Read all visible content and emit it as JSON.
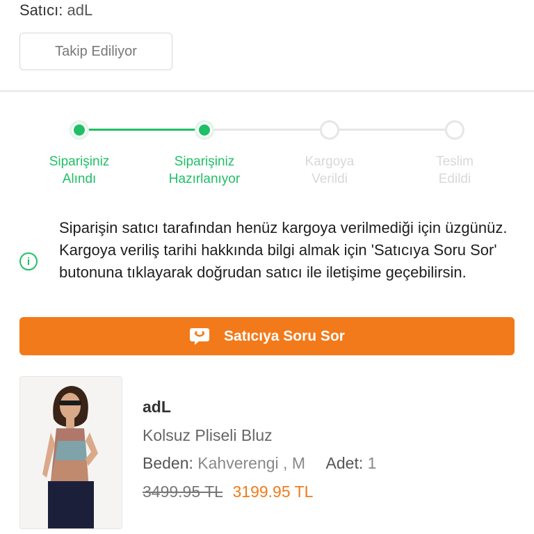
{
  "seller": {
    "label": "Satıcı:",
    "name": "adL",
    "follow_button": "Takip Ediliyor"
  },
  "tracker": {
    "steps": [
      {
        "label": "Siparişiniz\nAlındı",
        "status": "done"
      },
      {
        "label": "Siparişiniz\nHazırlanıyor",
        "status": "done"
      },
      {
        "label": "Kargoya\nVerildi",
        "status": "pending"
      },
      {
        "label": "Teslim\nEdildi",
        "status": "pending"
      }
    ],
    "colors": {
      "done": "#1fbf66",
      "pending": "#e6e6e6"
    }
  },
  "notice": {
    "icon": "info-icon",
    "text": "Siparişin satıcı tarafından henüz kargoya verilmediği için üzgünüz. Kargoya veriliş tarihi hakkında bilgi almak için 'Satıcıya Soru Sor' butonuna tıklayarak doğrudan satıcı ile iletişime geçebilirsin."
  },
  "ask_button": {
    "icon": "chat-icon",
    "label": "Satıcıya Soru Sor",
    "color": "#f27a1a"
  },
  "product": {
    "brand": "adL",
    "name": "Kolsuz Pliseli Bluz",
    "size_label": "Beden:",
    "size_value": "Kahverengi , M",
    "qty_label": "Adet:",
    "qty_value": "1",
    "old_price": "3499.95 TL",
    "new_price": "3199.95 TL"
  }
}
